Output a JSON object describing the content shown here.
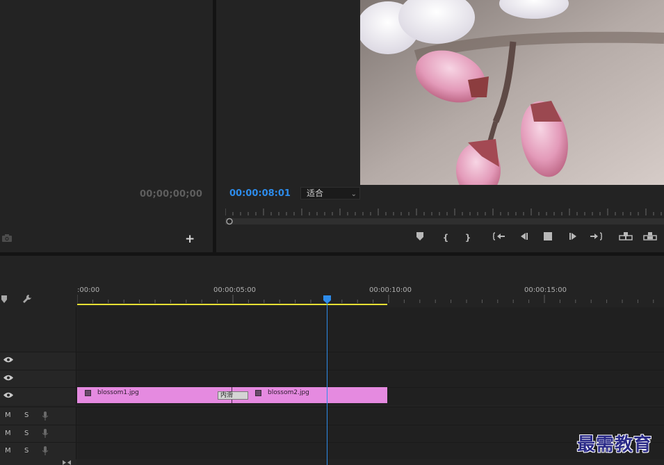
{
  "source_monitor": {
    "timecode": "00;00;00;00",
    "camera_icon": "camera-icon",
    "add_icon": "plus-icon",
    "add_label": "+"
  },
  "program_monitor": {
    "timecode": "00:00:08:01",
    "zoom_select": {
      "selected": "适合",
      "arrow": "⌄"
    },
    "controls": [
      {
        "name": "add-marker-button",
        "icon": "marker-icon",
        "glyph": "⬟"
      },
      {
        "name": "mark-in-button",
        "icon": "mark-in-icon",
        "glyph": "{"
      },
      {
        "name": "mark-out-button",
        "icon": "mark-out-icon",
        "glyph": "}"
      },
      {
        "name": "go-to-in-button",
        "icon": "go-to-in-icon",
        "glyph": "{←"
      },
      {
        "name": "step-back-button",
        "icon": "step-back-icon",
        "glyph": "◀▏"
      },
      {
        "name": "stop-button",
        "icon": "stop-icon",
        "glyph": "■"
      },
      {
        "name": "step-forward-button",
        "icon": "step-forward-icon",
        "glyph": "▕▶"
      },
      {
        "name": "go-to-out-button",
        "icon": "go-to-out-icon",
        "glyph": "→}"
      },
      {
        "name": "insert-button",
        "icon": "insert-icon",
        "glyph": "⊞"
      },
      {
        "name": "overwrite-button",
        "icon": "overwrite-icon",
        "glyph": "⊟"
      }
    ]
  },
  "timeline": {
    "ruler_labels": [
      ":00:00",
      "00:00:05:00",
      "00:00:10:00",
      "00:00:15:00"
    ],
    "playhead_time": "00:00:08:01",
    "video_tracks": [
      {
        "name": "video-track-3",
        "eye_icon": "eye-icon"
      },
      {
        "name": "video-track-2",
        "eye_icon": "eye-icon"
      },
      {
        "name": "video-track-1",
        "eye_icon": "eye-icon"
      }
    ],
    "audio_tracks": [
      {
        "name": "audio-track-1",
        "m": "M",
        "s": "S",
        "mic_icon": "microphone-icon"
      },
      {
        "name": "audio-track-2",
        "m": "M",
        "s": "S",
        "mic_icon": "microphone-icon"
      },
      {
        "name": "audio-track-3",
        "m": "M",
        "s": "S",
        "mic_icon": "microphone-icon"
      }
    ],
    "clips": [
      {
        "name": "blossom1.jpg",
        "icon": "fx-icon"
      },
      {
        "name": "blossom2.jpg",
        "icon": "fx-icon"
      }
    ],
    "transition_label": "内滑",
    "clip_color": "#e58ae0",
    "work_area_color": "#e6e033",
    "playhead_color": "#2d8ceb"
  },
  "watermark": "最需教育"
}
